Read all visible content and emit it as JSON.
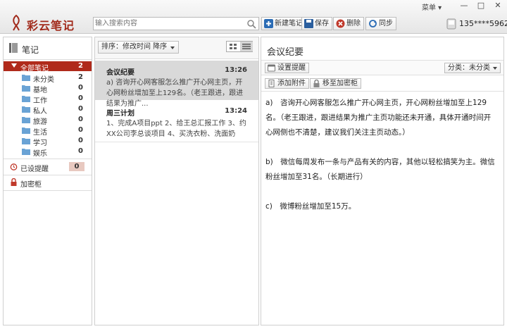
{
  "app": {
    "title": "彩云笔记",
    "menu_label": "菜单 ▾",
    "user_phone": "135****5962"
  },
  "search": {
    "placeholder": "输入搜索内容"
  },
  "toolbar": {
    "new_note": "新建笔记",
    "save": "保存",
    "delete": "删除",
    "sync": "同步"
  },
  "sidebar": {
    "header": "笔记",
    "all_notes": {
      "label": "全部笔记",
      "count": "2"
    },
    "folders": [
      {
        "label": "未分类",
        "count": "2"
      },
      {
        "label": "基地",
        "count": "0"
      },
      {
        "label": "工作",
        "count": "0"
      },
      {
        "label": "私人",
        "count": "0"
      },
      {
        "label": "旅游",
        "count": "0"
      },
      {
        "label": "生活",
        "count": "0"
      },
      {
        "label": "学习",
        "count": "0"
      },
      {
        "label": "娱乐",
        "count": "0"
      }
    ],
    "reminder": {
      "label": "已设提醒",
      "count": "0"
    },
    "vault": {
      "label": "加密柜"
    }
  },
  "note_list": {
    "sort_label": "排序：修改时间 降序",
    "notes": [
      {
        "title": "会议纪要",
        "time": "13:26",
        "preview": "a) 咨询开心网客服怎么推广开心网主页，开心网粉丝增加至上129名。（老王跟进，跟进结果为推广..."
      },
      {
        "title": "周三计划",
        "time": "13:24",
        "preview": "1、完成A项目ppt 2、给王总汇报工作 3、约XX公司李总谈项目 4、买洗衣粉、洗面奶"
      }
    ]
  },
  "editor": {
    "title": "会议纪要",
    "set_reminder": "设置提醒",
    "category": "分类：未分类",
    "add_attachment": "添加附件",
    "move_to_vault": "移至加密柜",
    "paragraphs": [
      "a)　咨询开心网客服怎么推广开心网主页，开心网粉丝增加至上129名。（老王跟进，跟进结果为推广主页功能还未开通，具体开通时间开心网侧也不清楚，建议我们关注主页动态。）",
      "b)　微信每周发布一条与产品有关的内容，其他以轻松搞笑为主。微信粉丝增加至31名。（长期进行）",
      "c)　微博粉丝增加至15万。"
    ]
  },
  "colors": {
    "accent": "#b02a1b",
    "brand_text": "#a12a1b"
  }
}
